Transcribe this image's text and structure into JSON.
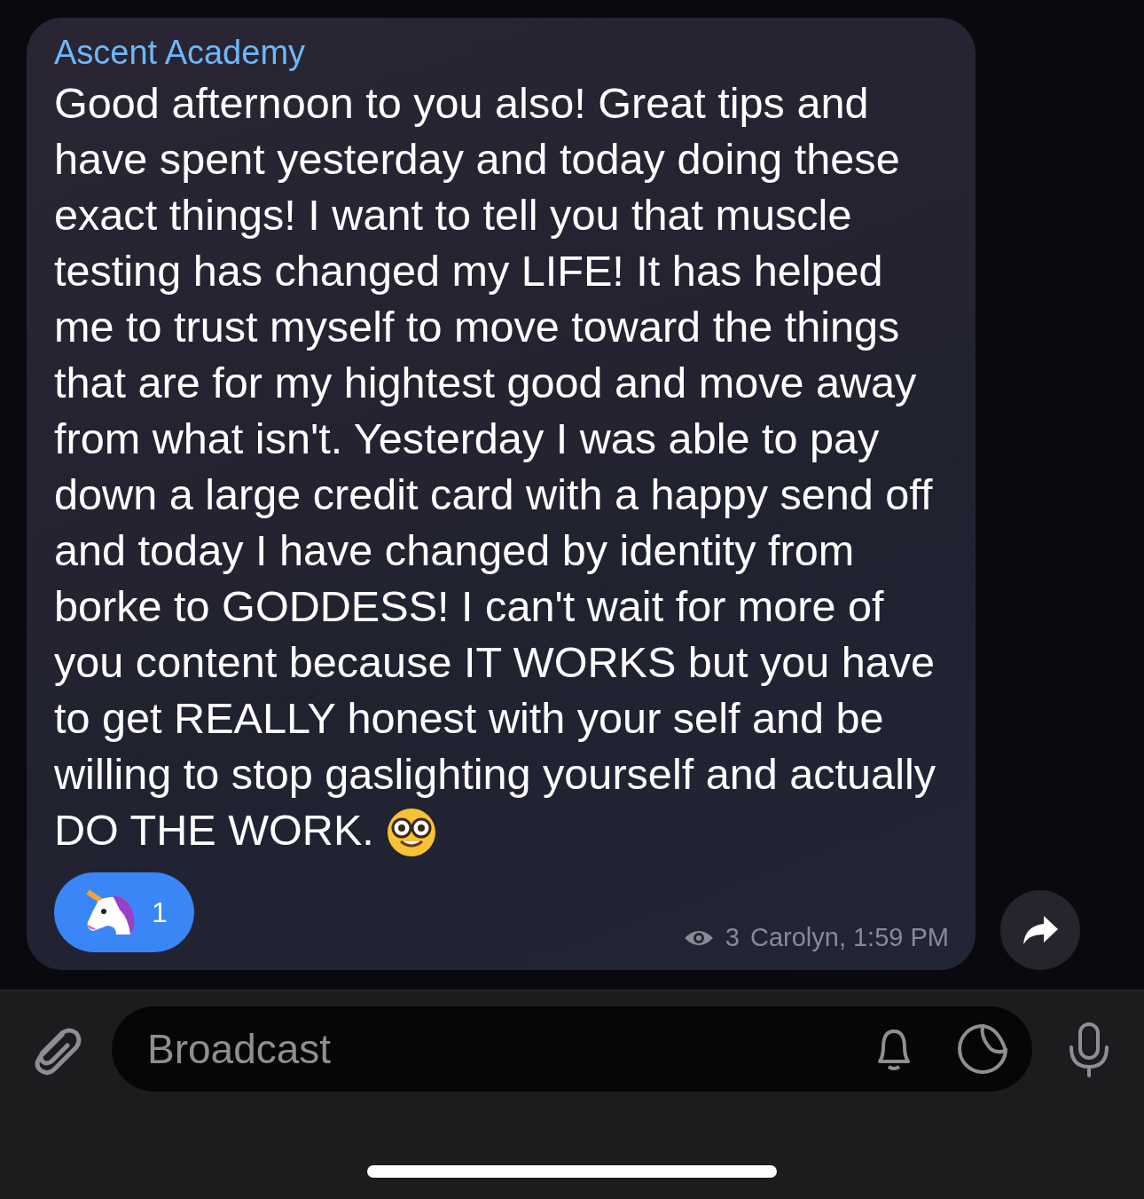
{
  "message": {
    "sender": "Ascent Academy",
    "text": "Good afternoon to you also! Great tips and have spent yesterday and today doing these exact things! I want to tell you that muscle testing has changed my LIFE! It has helped me to trust myself to move toward the things that are for my hightest good and move away from what isn't. Yesterday I was able to pay down a large credit card with a happy send off and today I have changed by identity from borke to GODDESS! I can't wait for more of you content because IT WORKS but you have to get REALLY honest with your self and be willing to stop gaslighting yourself and actually DO THE WORK.",
    "reaction": {
      "count": "1",
      "selected": true
    },
    "views": "3",
    "signature": "Carolyn, 1:59 PM"
  },
  "composer": {
    "placeholder": "Broadcast"
  }
}
